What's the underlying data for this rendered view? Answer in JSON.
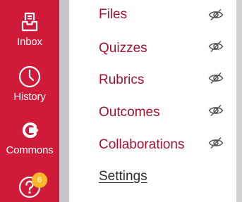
{
  "global_nav": {
    "bg_color": "#d01a3a",
    "items": [
      {
        "label": "Inbox",
        "icon": "inbox-icon"
      },
      {
        "label": "History",
        "icon": "clock-icon"
      },
      {
        "label": "Commons",
        "icon": "commons-icon"
      },
      {
        "label": "",
        "icon": "help-icon",
        "badge": "6"
      }
    ]
  },
  "course_nav": {
    "link_color": "#a3122f",
    "items": [
      {
        "label": "Files",
        "hidden_icon": "eye-slash-icon"
      },
      {
        "label": "Quizzes",
        "hidden_icon": "eye-slash-icon"
      },
      {
        "label": "Rubrics",
        "hidden_icon": "eye-slash-icon"
      },
      {
        "label": "Outcomes",
        "hidden_icon": "eye-slash-icon"
      },
      {
        "label": "Collaborations",
        "hidden_icon": "eye-slash-icon"
      },
      {
        "label": "Settings"
      }
    ]
  }
}
